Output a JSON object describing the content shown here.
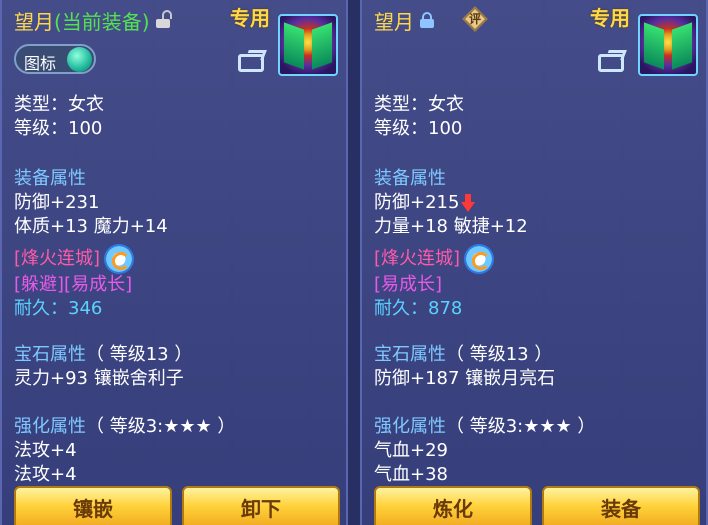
{
  "left_panel": {
    "title": "望月",
    "title_suffix": "(当前装备)",
    "exclusive_label": "专用",
    "icon_toggle_label": "图标",
    "type_line": "类型：女衣",
    "level_line": "等级：100",
    "attr_header": "装备属性",
    "attr_lines": [
      "防御+231",
      "体质+13 魔力+14"
    ],
    "special_line1": "[烽火连城]",
    "special_line2": "[躲避][易成长]",
    "durability_label": "耐久：",
    "durability_value": "346",
    "gem_header": "宝石属性",
    "gem_level": "（ 等级13 ）",
    "gem_line": "灵力+93 镶嵌舍利子",
    "enhance_header": "强化属性",
    "enhance_level": "（ 等级3:★★★ ）",
    "enhance_lines": [
      "法攻+4",
      "法攻+4"
    ],
    "button_1": "镶嵌",
    "button_2": "卸下"
  },
  "right_panel": {
    "title": "望月",
    "eval_badge": "评",
    "exclusive_label": "专用",
    "type_line": "类型：女衣",
    "level_line": "等级：100",
    "attr_header": "装备属性",
    "attr_lines": [
      "防御+215",
      "力量+18 敏捷+12"
    ],
    "special_line1": "[烽火连城]",
    "special_line2": "[易成长]",
    "durability_label": "耐久：",
    "durability_value": "878",
    "gem_header": "宝石属性",
    "gem_level": "（ 等级13 ）",
    "gem_line": "防御+187 镶嵌月亮石",
    "enhance_header": "强化属性",
    "enhance_level": "（ 等级3:★★★ ）",
    "enhance_lines": [
      "气血+29",
      "气血+38"
    ],
    "button_1": "炼化",
    "button_2": "装备"
  },
  "colors": {
    "title": "#ffd84a",
    "current_tag": "#52e252",
    "section_header": "#7ec8ff",
    "special_red": "#ff5aa8",
    "special_magenta": "#e65ae6",
    "durability_value": "#5ad2ff",
    "button": "#ffd23a"
  },
  "icons": [
    "unlocked-lock-icon",
    "locked-lock-icon",
    "share-icon",
    "refresh-icon",
    "down-arrow-icon",
    "equipment-icon"
  ]
}
